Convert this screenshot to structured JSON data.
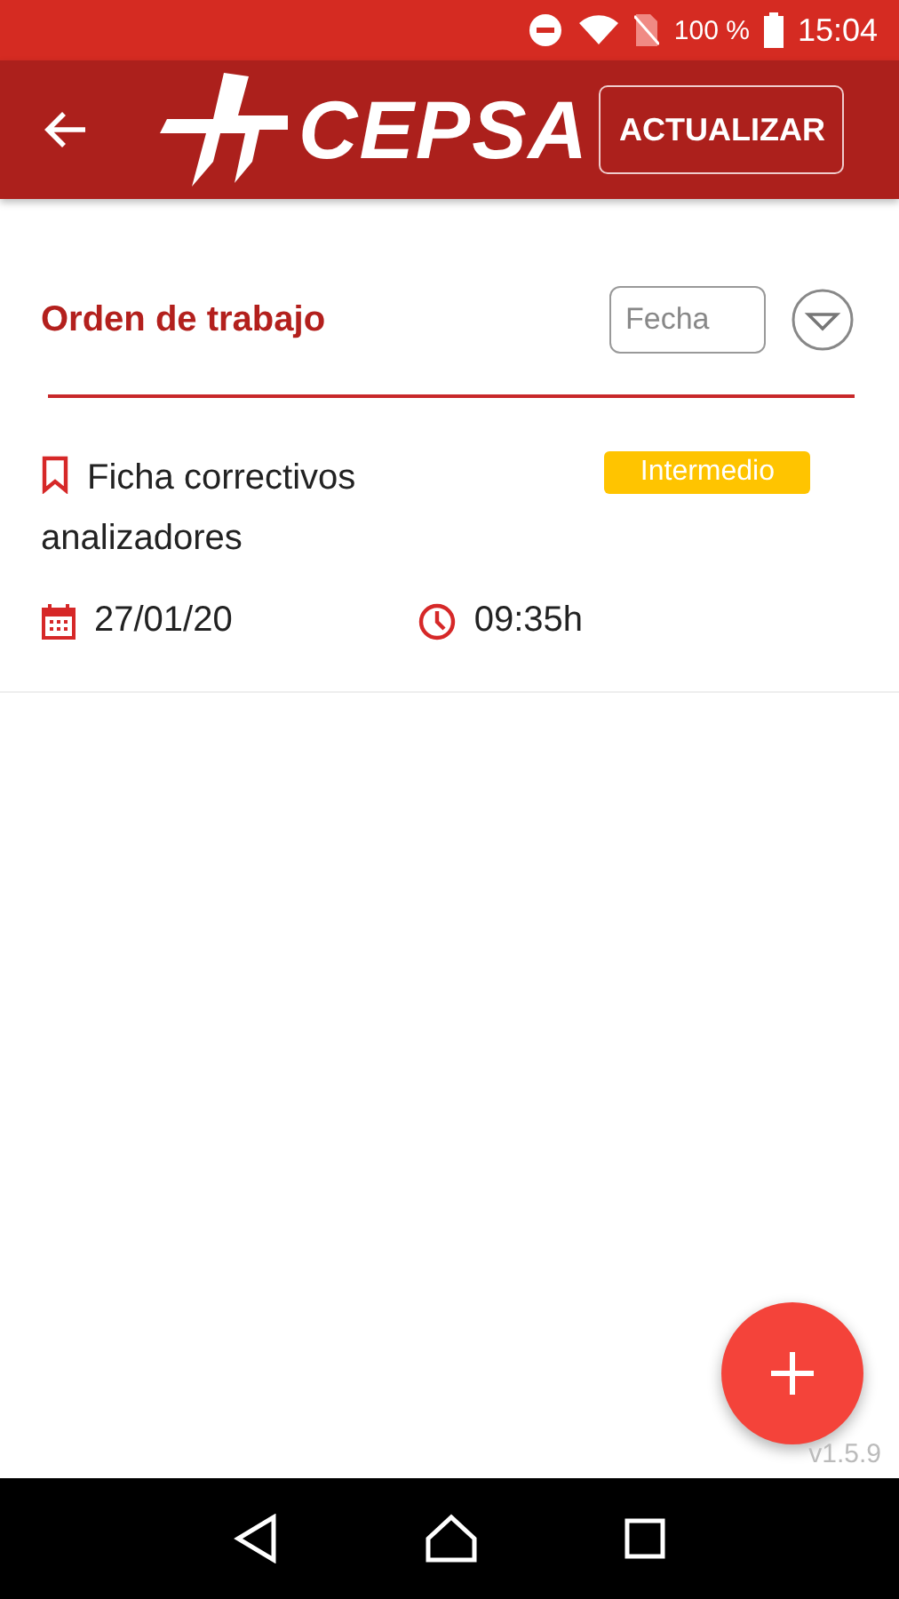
{
  "status_bar": {
    "battery": "100 %",
    "time": "15:04"
  },
  "app_bar": {
    "logo_text": "CEPSA",
    "action": "ACTUALIZAR"
  },
  "header": {
    "title": "Orden de trabajo",
    "date_filter": {
      "placeholder": "Fecha"
    }
  },
  "orders": [
    {
      "title": "Ficha correctivos analizadores",
      "tag": {
        "label": "Intermedio",
        "color": "#ffc400"
      },
      "date": "27/01/20",
      "time": "09:35h"
    }
  ],
  "version": "v1.5.9"
}
